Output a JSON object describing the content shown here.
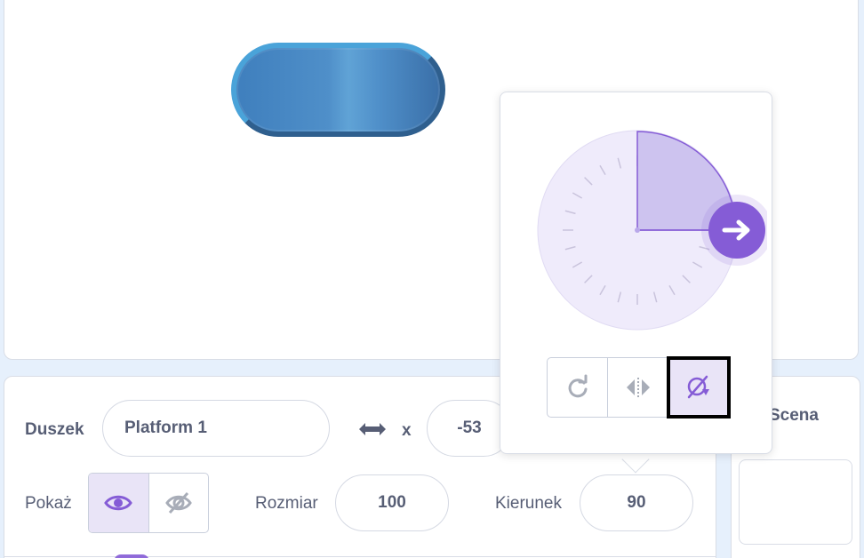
{
  "sprite_panel": {
    "sprite_label": "Duszek",
    "sprite_name": "Platform 1",
    "x_label": "x",
    "x_value": "-53",
    "show_label": "Pokaż",
    "size_label": "Rozmiar",
    "size_value": "100",
    "direction_label": "Kierunek",
    "direction_value": "90"
  },
  "scene_panel": {
    "title": "Scena"
  },
  "direction_popover": {
    "direction_value": 90,
    "rotation_styles": [
      "all-around-icon",
      "left-right-icon",
      "dont-rotate-icon"
    ],
    "selected_style": "dont-rotate-icon"
  },
  "colors": {
    "accent": "#855cd6",
    "accent_light": "#e9e4f7",
    "dial_fill": "#efebfb",
    "text": "#575e75",
    "panel_bg": "#e6f0fc"
  }
}
